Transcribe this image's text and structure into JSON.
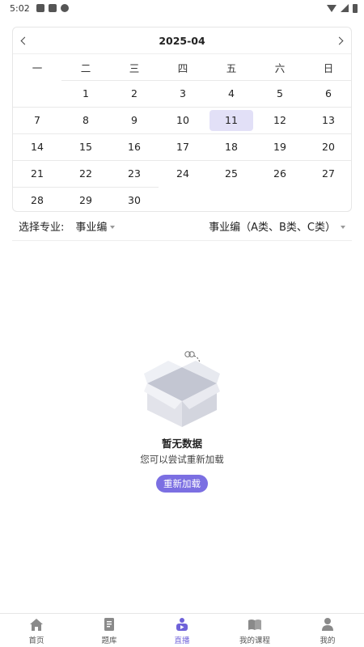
{
  "status_bar": {
    "time": "5:02"
  },
  "calendar": {
    "title": "2025-04",
    "weekdays": [
      "一",
      "二",
      "三",
      "四",
      "五",
      "六",
      "日"
    ],
    "weeks": [
      [
        "",
        "1",
        "2",
        "3",
        "4",
        "5",
        "6"
      ],
      [
        "7",
        "8",
        "9",
        "10",
        "11",
        "12",
        "13"
      ],
      [
        "14",
        "15",
        "16",
        "17",
        "18",
        "19",
        "20"
      ],
      [
        "21",
        "22",
        "23",
        "24",
        "25",
        "26",
        "27"
      ],
      [
        "28",
        "29",
        "30",
        "",
        "",
        "",
        ""
      ]
    ],
    "selected_day": "11",
    "selected_color": "#e2e0f7"
  },
  "major": {
    "label": "选择专业:",
    "selected": "事业编",
    "sub_selected": "事业编（A类、B类、C类）"
  },
  "empty_state": {
    "title": "暂无数据",
    "description": "您可以尝试重新加载",
    "reload_label": "重新加载",
    "accent_color": "#7b6fe2"
  },
  "tabs": [
    {
      "label": "首页",
      "icon": "home-icon",
      "active": false
    },
    {
      "label": "题库",
      "icon": "question-bank-icon",
      "active": false
    },
    {
      "label": "直播",
      "icon": "live-icon",
      "active": true
    },
    {
      "label": "我的课程",
      "icon": "courses-icon",
      "active": false
    },
    {
      "label": "我的",
      "icon": "profile-icon",
      "active": false
    }
  ]
}
